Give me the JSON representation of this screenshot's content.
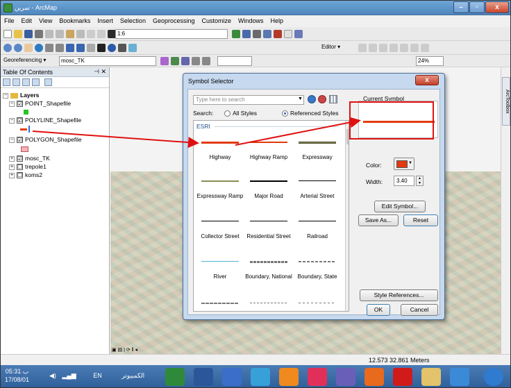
{
  "window": {
    "title": "تمرين - ArcMap"
  },
  "menu": [
    "File",
    "Edit",
    "View",
    "Bookmarks",
    "Insert",
    "Selection",
    "Geoprocessing",
    "Customize",
    "Windows",
    "Help"
  ],
  "toolbar": {
    "scale_value": "1:6",
    "editor_label": "Editor ▾",
    "zoom_value": "24%"
  },
  "georef": {
    "label": "Georeferencing ▾",
    "layer_value": "mosc_TK"
  },
  "toc": {
    "title": "Table Of Contents",
    "root_label": "Layers",
    "layers": [
      {
        "name": "POINT_Shapefile",
        "checked": "☑"
      },
      {
        "name": "POLYLINE_Shapefile",
        "checked": "☑"
      },
      {
        "name": "POLYGON_Shapefile",
        "checked": "☑"
      },
      {
        "name": "mosc_TK",
        "checked": "☑"
      },
      {
        "name": "trepole1",
        "checked": "☐"
      },
      {
        "name": "koms2",
        "checked": "☐"
      }
    ]
  },
  "side_tab": "ArcToolbox",
  "status": {
    "coords": "12.573  32.861 Meters"
  },
  "taskbar": {
    "time": "ب 05:31",
    "date": "17/08/01",
    "lang": "EN",
    "tray_text": "الكمبيوتر"
  },
  "dialog": {
    "title": "Symbol Selector",
    "close": "x",
    "search_placeholder": "Type here to search",
    "search_label": "Search:",
    "radio_all": "All Styles",
    "radio_ref": "Referenced Styles",
    "group": "ESRI",
    "symbols": [
      {
        "label": "Highway",
        "color": "#e23a0e"
      },
      {
        "label": "Highway Ramp",
        "color": "#e23a0e"
      },
      {
        "label": "Expressway",
        "color": "#8a8a55"
      },
      {
        "label": "Expressway Ramp",
        "color": "#8a8a55"
      },
      {
        "label": "Major Road",
        "color": "#000000"
      },
      {
        "label": "Arterial Street",
        "color": "#000000"
      },
      {
        "label": "Collector Street",
        "color": "#000000"
      },
      {
        "label": "Residential Street",
        "color": "#000000"
      },
      {
        "label": "Railroad",
        "color": "#000000"
      },
      {
        "label": "River",
        "color": "#4fb6d6"
      },
      {
        "label": "Boundary, National",
        "color": "#777777"
      },
      {
        "label": "Boundary, State",
        "color": "#777777"
      }
    ],
    "current_symbol_label": "Current Symbol",
    "color_label": "Color:",
    "symbol_color": "#e23a0e",
    "width_label": "Width:",
    "width_value": "3.40",
    "edit_symbol": "Edit Symbol...",
    "save_as": "Save As...",
    "reset": "Reset",
    "style_references": "Style References...",
    "ok": "OK",
    "cancel": "Cancel"
  }
}
